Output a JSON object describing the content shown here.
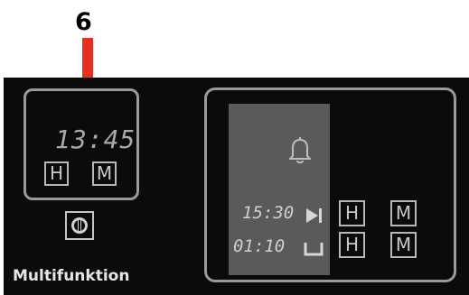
{
  "annotation": {
    "number": "6",
    "arrow_color": "#e53023"
  },
  "left_display": {
    "time": "13:45",
    "hours_key": "H",
    "minutes_key": "M",
    "power_icon": "power-icon",
    "mode_label": "Multifunktion"
  },
  "right_display": {
    "bell_icon": "bell-icon",
    "time_1": "15:30",
    "end_icon": "play-end-icon",
    "time_2": "01:10",
    "pot_icon": "pot-icon",
    "keys": {
      "h_top": "H",
      "m_top": "M",
      "h_bottom": "H",
      "m_bottom": "M"
    }
  },
  "colors": {
    "panel": "#0b0b0b",
    "frame": "#9a9a9a",
    "lcd": "#5a5a5a",
    "text": "#e6e6e6"
  }
}
